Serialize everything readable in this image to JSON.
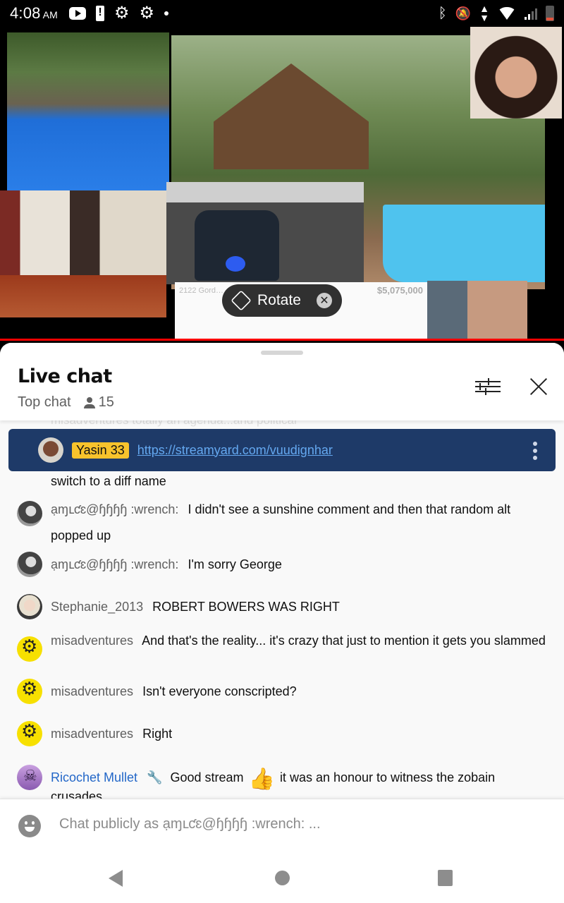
{
  "status_bar": {
    "time": "4:08",
    "ampm": "AM",
    "left_icons": [
      "youtube-icon",
      "battery-alert-icon",
      "settings-icon",
      "settings-icon",
      "notification-dot-icon"
    ],
    "right_icons": [
      "bluetooth-icon",
      "notifications-off-icon",
      "data-activity-icon",
      "wifi-icon",
      "cell-signal-icon",
      "battery-low-icon"
    ]
  },
  "video": {
    "rotate_chip": {
      "label": "Rotate",
      "icon": "screen-rotation-icon",
      "close_icon": "close-circle-icon"
    },
    "overlay_text": {
      "listing_address": "2122 Gord…",
      "listing_price": "$5,075,000"
    },
    "progress_color": "#ff0000"
  },
  "chat": {
    "title": "Live chat",
    "mode": "Top chat",
    "viewer_count": "15",
    "faded_message": "misadventures   totally an agenda...and political",
    "pinned": {
      "author": "Yasin 33",
      "link": "https://streamyard.com/vuudignhar",
      "background": "#1e3a68",
      "badge_color": "#f8c32c"
    },
    "messages": [
      {
        "author": "",
        "text": "switch to a diff name",
        "avatar": "bw"
      },
      {
        "author": "ạɱւƈɛ@ɧɧɧɧ :wrench:",
        "text": "I didn't see a sunshine comment and then that random alt popped up",
        "avatar": "bw"
      },
      {
        "author": "ạɱւƈɛ@ɧɧɧɧ :wrench:",
        "text": "I'm sorry George",
        "avatar": "bw"
      },
      {
        "author": "Stephanie_2013",
        "text": "ROBERT BOWERS WAS RIGHT",
        "avatar": "steph"
      },
      {
        "author": "misadventures",
        "text": "And that's the reality... it's crazy that just to mention it gets you slammed",
        "avatar": "mis"
      },
      {
        "author": "misadventures",
        "text": "Isn't everyone conscripted?",
        "avatar": "mis"
      },
      {
        "author": "misadventures",
        "text": "Right",
        "avatar": "mis"
      },
      {
        "author": "Ricochet Mullet",
        "text_before": "Good stream",
        "emoji": "👍",
        "text_after": "it was an honour to witness the zobain crusades",
        "avatar": "rico",
        "member_color": "#2367c8",
        "badge": "wrench-icon"
      }
    ],
    "input_placeholder": "Chat publicly as ạɱւƈɛ@ɧɧɧɧ :wrench: ..."
  },
  "nav_bar": {
    "buttons": [
      "back",
      "home",
      "recents"
    ]
  }
}
